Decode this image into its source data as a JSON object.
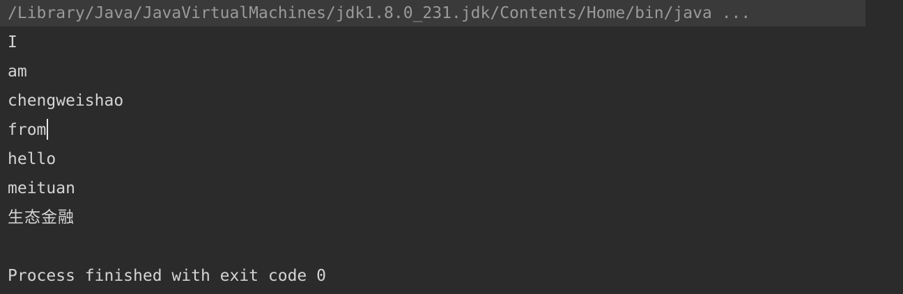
{
  "console": {
    "command": "/Library/Java/JavaVirtualMachines/jdk1.8.0_231.jdk/Contents/Home/bin/java ...",
    "output_lines": [
      "I",
      "am",
      "chengweishao",
      "from",
      "hello",
      "meituan",
      "生态金融"
    ],
    "exit_message": "Process finished with exit code 0"
  }
}
